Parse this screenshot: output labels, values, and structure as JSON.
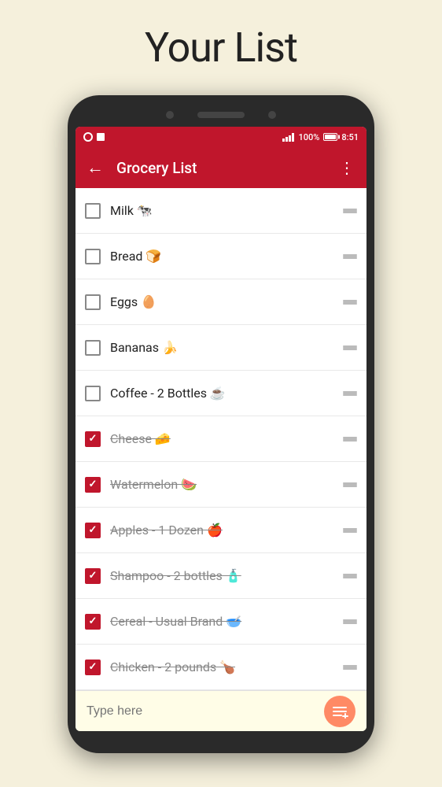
{
  "page": {
    "title": "Your List"
  },
  "toolbar": {
    "back_label": "←",
    "title": "Grocery List",
    "menu_label": "⋮"
  },
  "status_bar": {
    "time": "8:51",
    "battery_percent": "100%"
  },
  "grocery_items": [
    {
      "id": 1,
      "text": "Milk 🐄",
      "checked": false
    },
    {
      "id": 2,
      "text": "Bread 🍞",
      "checked": false
    },
    {
      "id": 3,
      "text": "Eggs 🥚",
      "checked": false
    },
    {
      "id": 4,
      "text": "Bananas 🍌",
      "checked": false
    },
    {
      "id": 5,
      "text": "Coffee - 2 Bottles ☕",
      "checked": false
    },
    {
      "id": 6,
      "text": "Cheese 🧀",
      "checked": true
    },
    {
      "id": 7,
      "text": "Watermelon 🍉",
      "checked": true
    },
    {
      "id": 8,
      "text": "Apples - 1 Dozen 🍎",
      "checked": true
    },
    {
      "id": 9,
      "text": "Shampoo - 2 bottles 🧴",
      "checked": true
    },
    {
      "id": 10,
      "text": "Cereal - Usual Brand 🥣",
      "checked": true
    },
    {
      "id": 11,
      "text": "Chicken - 2 pounds 🍗",
      "checked": true
    }
  ],
  "bottom_bar": {
    "placeholder": "Type here",
    "fab_icon": "≡+"
  }
}
